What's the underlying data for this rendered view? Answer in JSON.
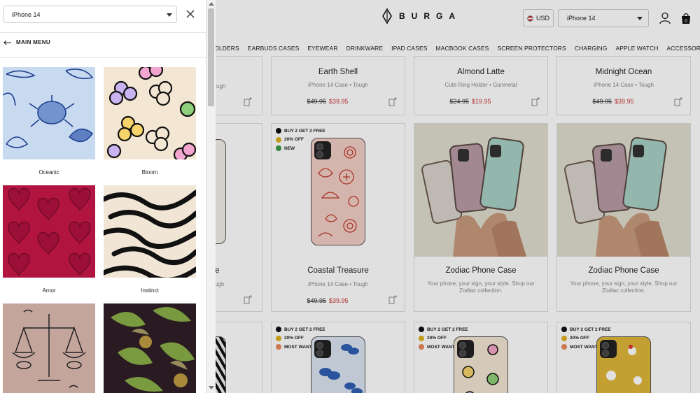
{
  "header": {
    "brand": "BURGA",
    "currency": "USD",
    "device": "iPhone 14"
  },
  "nav": [
    "HOLDERS",
    "EARBUDS CASES",
    "EYEWEAR",
    "DRINKWARE",
    "IPAD CASES",
    "MACBOOK CASES",
    "SCREEN PROTECTORS",
    "CHARGING",
    "APPLE WATCH",
    "ACCESSORIES"
  ],
  "products_row1": [
    {
      "title": "Earth Shell",
      "sub": "iPhone 14 Case • Tough",
      "old": "$49.95",
      "price": "$39.95"
    },
    {
      "title": "Almond Latte",
      "sub": "Cute Ring Holder • Gunmetal",
      "old": "$24.95",
      "price": "$19.95"
    },
    {
      "title": "Midnight Ocean",
      "sub": "iPhone 14 Case • Tough",
      "old": "$49.95",
      "price": "$39.95"
    }
  ],
  "partial_left": {
    "sub_fragment": "ugh",
    "title_fragment": "e"
  },
  "products_row2": [
    {
      "title": "Coastal Treasure",
      "sub": "iPhone 14 Case • Tough",
      "old": "$49.95",
      "price": "$39.95",
      "badges": [
        "BUY 2 GET 2 FREE",
        "20% OFF",
        "NEW"
      ]
    },
    {
      "title": "Zodiac Phone Case",
      "desc": "Your phone, your sign, your style. Shop our Zodiac collection."
    },
    {
      "title": "Zodiac Phone Case",
      "desc": "Your phone, your sign, your style. Shop our Zodiac collection."
    }
  ],
  "row3_badges": [
    "BUY 2 GET 2 FREE",
    "20% OFF",
    "MOST WANTED"
  ],
  "row3_badges_short": [
    "BUY 2 GET 2 FREE",
    "20% OFF",
    "MOST WANT..."
  ],
  "drawer": {
    "device": "iPhone 14",
    "back_label": "MAIN MENU",
    "tiles": [
      "Oceanic",
      "Bloom",
      "Amor",
      "Instinct"
    ]
  },
  "colors": {
    "sale_red": "#cc3333",
    "amor_bg": "#b0143f",
    "oceanic_bg": "#c8daf0"
  }
}
